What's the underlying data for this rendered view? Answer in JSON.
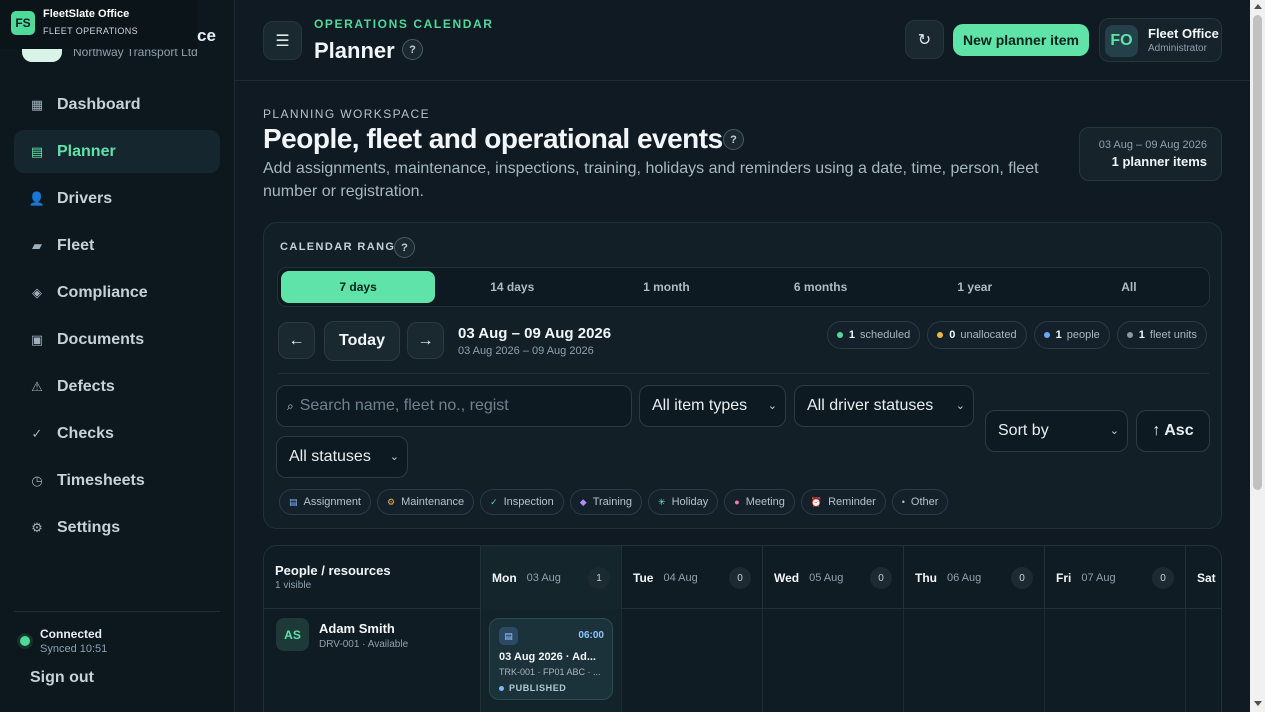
{
  "os_badge": {
    "logo": "FS",
    "title": "FleetSlate Office",
    "subtitle": "FLEET OPERATIONS"
  },
  "brand": {
    "name_fragment": "ce",
    "company": "Northway Transport Ltd"
  },
  "sidebar": {
    "items": [
      {
        "label": "Dashboard",
        "icon": "dashboard-icon",
        "glyph": "▦",
        "active": false
      },
      {
        "label": "Planner",
        "icon": "planner-icon",
        "glyph": "▤",
        "active": true
      },
      {
        "label": "Drivers",
        "icon": "drivers-icon",
        "glyph": "👤",
        "active": false
      },
      {
        "label": "Fleet",
        "icon": "fleet-icon",
        "glyph": "▰",
        "active": false
      },
      {
        "label": "Compliance",
        "icon": "compliance-icon",
        "glyph": "◈",
        "active": false
      },
      {
        "label": "Documents",
        "icon": "documents-icon",
        "glyph": "▣",
        "active": false
      },
      {
        "label": "Defects",
        "icon": "defects-icon",
        "glyph": "⚠",
        "active": false
      },
      {
        "label": "Checks",
        "icon": "checks-icon",
        "glyph": "✓",
        "active": false
      },
      {
        "label": "Timesheets",
        "icon": "timesheets-icon",
        "glyph": "◷",
        "active": false
      },
      {
        "label": "Settings",
        "icon": "settings-icon",
        "glyph": "⚙",
        "active": false
      }
    ],
    "connection": {
      "status": "Connected",
      "synced": "Synced 10:51"
    },
    "sign_out": "Sign out"
  },
  "header": {
    "eyebrow": "OPERATIONS CALENDAR",
    "title": "Planner",
    "help": "?",
    "new_button": "New planner item",
    "user": {
      "initials": "FO",
      "name": "Fleet Office",
      "role": "Administrator"
    }
  },
  "workspace": {
    "eyebrow": "PLANNING WORKSPACE",
    "title": "People, fleet and operational events",
    "description": "Add assignments, maintenance, inspections, training, holidays and reminders using a date, time, person, fleet number or registration.",
    "range_card": {
      "range": "03 Aug – 09 Aug 2026",
      "count": "1 planner items"
    }
  },
  "calendar_range": {
    "label": "CALENDAR RANGE",
    "options": [
      {
        "label": "7 days",
        "active": true
      },
      {
        "label": "14 days",
        "active": false
      },
      {
        "label": "1 month",
        "active": false
      },
      {
        "label": "6 months",
        "active": false
      },
      {
        "label": "1 year",
        "active": false
      },
      {
        "label": "All",
        "active": false
      }
    ],
    "today": "Today",
    "date_main": "03 Aug – 09 Aug 2026",
    "date_sub": "03 Aug 2026 – 09 Aug 2026",
    "stats": [
      {
        "count": "1",
        "label": "scheduled",
        "color": "#4fd99b"
      },
      {
        "count": "0",
        "label": "unallocated",
        "color": "#f2b544"
      },
      {
        "count": "1",
        "label": "people",
        "color": "#6aa8ff"
      },
      {
        "count": "1",
        "label": "fleet units",
        "color": "#8b98a2"
      }
    ],
    "search_placeholder": "Search name, fleet no., regist",
    "filters": {
      "item_types": "All item types",
      "driver_statuses": "All driver statuses",
      "sort": "Sort by",
      "order": "↑ Asc",
      "statuses": "All statuses"
    },
    "chips": [
      {
        "label": "Assignment",
        "glyph": "▤",
        "color": "#7cb8ff"
      },
      {
        "label": "Maintenance",
        "glyph": "⚙",
        "color": "#f2b544"
      },
      {
        "label": "Inspection",
        "glyph": "✓",
        "color": "#4fd99b"
      },
      {
        "label": "Training",
        "glyph": "◆",
        "color": "#b48cff"
      },
      {
        "label": "Holiday",
        "glyph": "✳",
        "color": "#5fe3d0"
      },
      {
        "label": "Meeting",
        "glyph": "●",
        "color": "#ff7aa8"
      },
      {
        "label": "Reminder",
        "glyph": "⏰",
        "color": "#ff9a5c"
      },
      {
        "label": "Other",
        "glyph": "•",
        "color": "#b5c2ca"
      }
    ]
  },
  "grid": {
    "resource_header": {
      "title": "People / resources",
      "subtitle": "1 visible"
    },
    "days": [
      {
        "name": "Mon",
        "date": "03 Aug",
        "count": "1",
        "today": true
      },
      {
        "name": "Tue",
        "date": "04 Aug",
        "count": "0",
        "today": false
      },
      {
        "name": "Wed",
        "date": "05 Aug",
        "count": "0",
        "today": false
      },
      {
        "name": "Thu",
        "date": "06 Aug",
        "count": "0",
        "today": false
      },
      {
        "name": "Fri",
        "date": "07 Aug",
        "count": "0",
        "today": false
      },
      {
        "name": "Sat",
        "date": "",
        "count": "",
        "today": false
      }
    ],
    "resource": {
      "initials": "AS",
      "name": "Adam Smith",
      "meta": "DRV-001 · Available"
    },
    "event": {
      "time": "06:00",
      "title": "03 Aug 2026 · Ad...",
      "subtitle": "TRK-001 · FP01 ABC · ...",
      "status": "PUBLISHED"
    }
  }
}
